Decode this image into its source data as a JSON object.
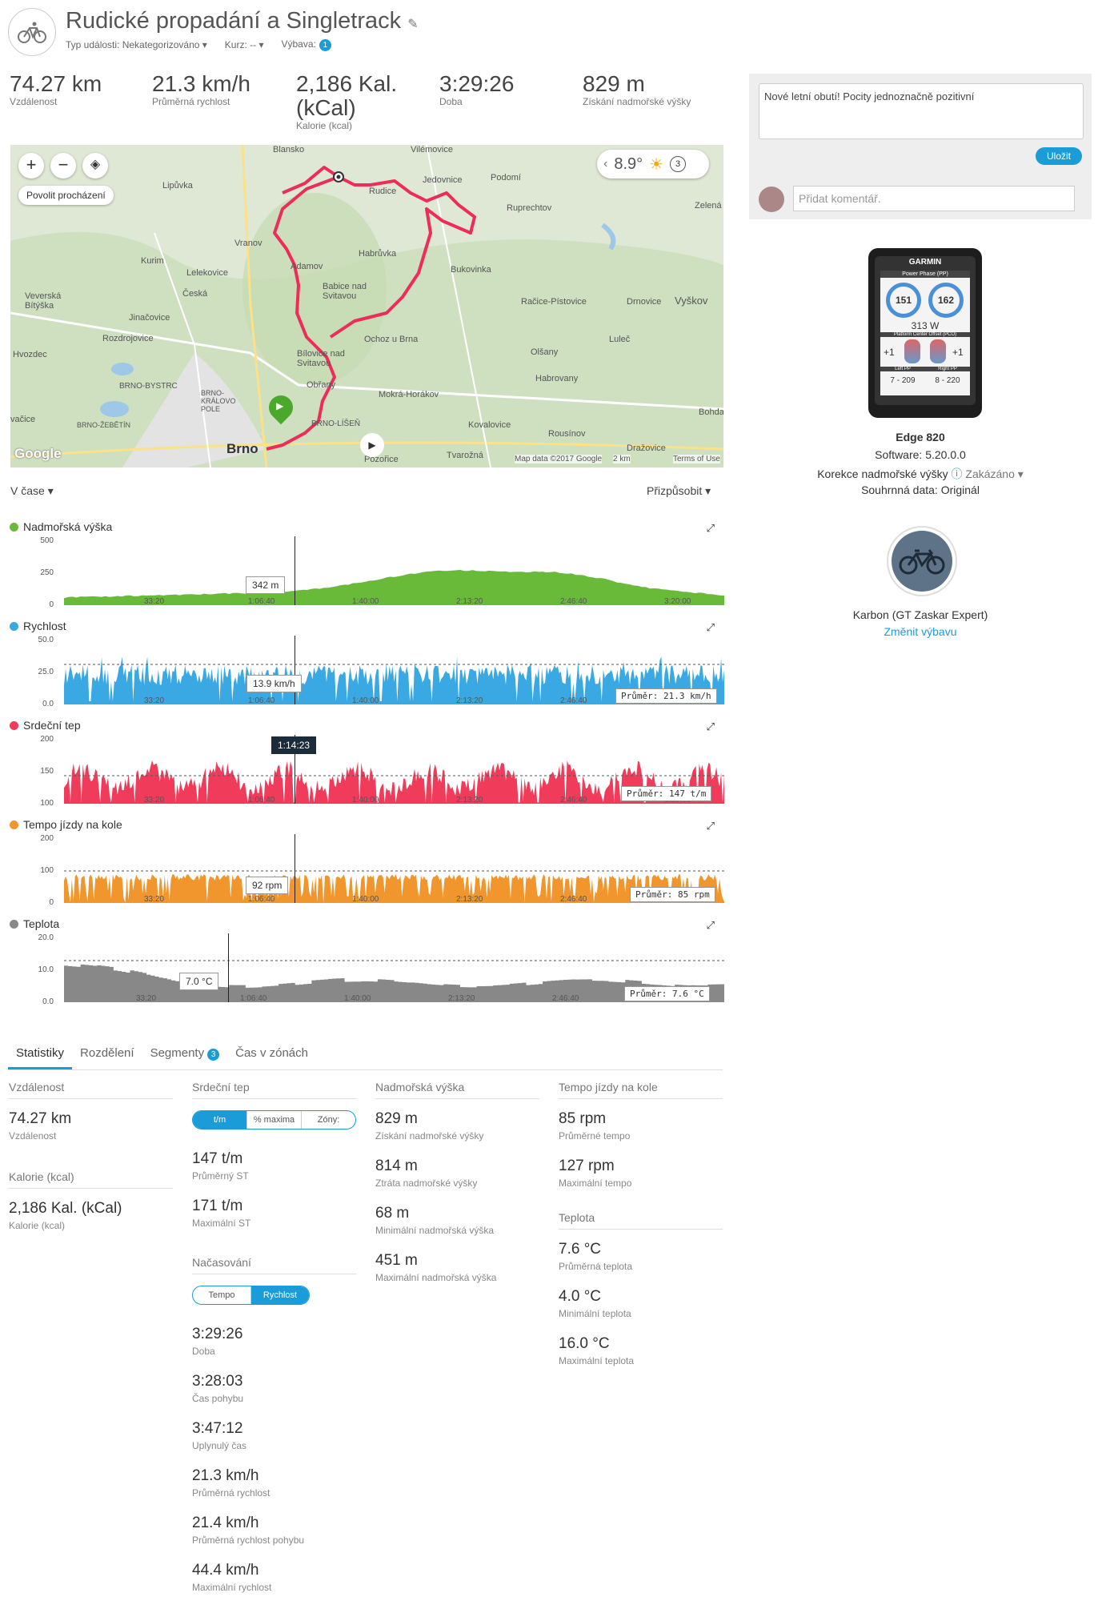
{
  "header": {
    "title": "Rudické propadání a Singletrack",
    "event_type": "Typ události: Nekategorizováno",
    "course": "Kurz: --",
    "gear_label": "Výbava:",
    "gear_count": "1"
  },
  "summary": [
    {
      "value": "74.27 km",
      "label": "Vzdálenost"
    },
    {
      "value": "21.3 km/h",
      "label": "Průměrná rychlost"
    },
    {
      "value": "2,186 Kal. (kCal)",
      "label": "Kalorie (kcal)"
    },
    {
      "value": "3:29:26",
      "label": "Doba"
    },
    {
      "value": "829 m",
      "label": "Získání nadmořské výšky"
    }
  ],
  "map": {
    "pan_label": "Povolit procházení",
    "temperature": "8.9°",
    "lap_count": "3",
    "credits": "Map data ©2017 Google",
    "scale": "2 km",
    "terms": "Terms of Use",
    "google": "Google",
    "places": [
      "Lipůvka",
      "Kurim",
      "Vranov",
      "Lelekovice",
      "Česká",
      "Veverská Bítýška",
      "Jinačovice",
      "Rozdrojovice",
      "Hvozdec",
      "BRNO-BYSTRC",
      "BRNO-KRÁLOVO POLE",
      "BRNO-ŽEBĚTÍN",
      "Brno",
      "Obřany",
      "Bílovice nad Svitavou",
      "Babice nad Svitavou",
      "Adamov",
      "Habrůvka",
      "Rudice",
      "Jedovnice",
      "Podomí",
      "Ruprechtov",
      "Bukovinka",
      "Račice-Pístovice",
      "Drnovice",
      "Vyškov",
      "Luleč",
      "Olšany",
      "Habrovany",
      "Ochoz u Brna",
      "Mokrá-Horákov",
      "BRNO-LÍŠEŇ",
      "Kovalovice",
      "Rousínov",
      "Tvarožná",
      "Pozořice",
      "Dražovice",
      "Zelená",
      "Vilémovice",
      "Blansko",
      "Bohda",
      "vačice"
    ]
  },
  "charts": {
    "mode": "V čase",
    "fit": "Přizpůsobit",
    "x_ticks": [
      "33:20",
      "1:06:40",
      "1:40:00",
      "2:13:20",
      "2:46:40",
      "3:20:00"
    ],
    "cursor_time": "1:14:23",
    "elevation": {
      "title": "Nadmořská výška",
      "color": "#6aba3a",
      "ticks": [
        "500",
        "250",
        "0"
      ],
      "tip": "342 m"
    },
    "speed": {
      "title": "Rychlost",
      "color": "#3aa9e3",
      "ticks": [
        "50.0",
        "25.0",
        "0.0"
      ],
      "tip": "13.9 km/h",
      "avg": "Průměr: 21.3 km/h"
    },
    "hr": {
      "title": "Srdeční tep",
      "color": "#f03c5a",
      "ticks": [
        "200",
        "150",
        "100"
      ],
      "avg": "Průměr: 147 t/m"
    },
    "cadence": {
      "title": "Tempo jízdy na kole",
      "color": "#f0962d",
      "ticks": [
        "200",
        "100",
        "0"
      ],
      "tip": "92 rpm",
      "avg": "Průměr: 85 rpm"
    },
    "temp": {
      "title": "Teplota",
      "color": "#888888",
      "ticks": [
        "20.0",
        "10.0",
        "0.0"
      ],
      "tip": "7.0 °C",
      "avg": "Průměr: 7.6 °C"
    }
  },
  "tabs": {
    "stats": "Statistiky",
    "splits": "Rozdělení",
    "segments": "Segmenty",
    "segments_count": "3",
    "zones": "Čas v zónách"
  },
  "stats": {
    "distance": {
      "header": "Vzdálenost",
      "value": "74.27 km",
      "label": "Vzdálenost"
    },
    "calories": {
      "header": "Kalorie (kcal)",
      "value": "2,186 Kal. (kCal)",
      "label": "Kalorie (kcal)"
    },
    "hr": {
      "header": "Srdeční tep",
      "seg": [
        "t/m",
        "% maxima",
        "Zóny:"
      ],
      "items": [
        {
          "value": "147 t/m",
          "label": "Průměrný ST"
        },
        {
          "value": "171 t/m",
          "label": "Maximální ST"
        }
      ]
    },
    "timing": {
      "header": "Načasování",
      "seg": [
        "Tempo",
        "Rychlost"
      ],
      "items": [
        {
          "value": "3:29:26",
          "label": "Doba"
        },
        {
          "value": "3:28:03",
          "label": "Čas pohybu"
        },
        {
          "value": "3:47:12",
          "label": "Uplynulý čas"
        },
        {
          "value": "21.3 km/h",
          "label": "Průměrná rychlost"
        },
        {
          "value": "21.4 km/h",
          "label": "Průměrná rychlost pohybu"
        },
        {
          "value": "44.4 km/h",
          "label": "Maximální rychlost"
        }
      ]
    },
    "elevation": {
      "header": "Nadmořská výška",
      "items": [
        {
          "value": "829 m",
          "label": "Získání nadmořské výšky"
        },
        {
          "value": "814 m",
          "label": "Ztráta nadmořské výšky"
        },
        {
          "value": "68 m",
          "label": "Minimální nadmořská výška"
        },
        {
          "value": "451 m",
          "label": "Maximální nadmořská výška"
        }
      ]
    },
    "cadence": {
      "header": "Tempo jízdy na kole",
      "items": [
        {
          "value": "85 rpm",
          "label": "Průměrné tempo"
        },
        {
          "value": "127 rpm",
          "label": "Maximální tempo"
        }
      ]
    },
    "temperature": {
      "header": "Teplota",
      "items": [
        {
          "value": "7.6 °C",
          "label": "Průměrná teplota"
        },
        {
          "value": "4.0 °C",
          "label": "Minimální teplota"
        },
        {
          "value": "16.0 °C",
          "label": "Maximální teplota"
        }
      ]
    }
  },
  "notes": {
    "text": "Nové letní obutí! Pocity jednoznačně pozitivní",
    "save": "Uložit",
    "comment_placeholder": "Přidat komentář."
  },
  "device": {
    "name": "Edge 820",
    "software": "Software: 5.20.0.0",
    "elev_corr_label": "Korekce nadmořské výšky",
    "elev_corr_value": "Zakázáno",
    "source": "Souhrnná data: Originál",
    "screen_brand": "GARMIN",
    "screen_title": "Power Phase (PP)",
    "screen_l": "151",
    "screen_r": "162",
    "screen_power": "313 W",
    "screen_pco": "Platform Center Offset (PCO)",
    "screen_pco_l": "+1",
    "screen_pco_r": "+1",
    "screen_lpp": "Left PP",
    "screen_rpp": "Right PP",
    "screen_lpp_v": "7 - 209",
    "screen_rpp_v": "8 - 220"
  },
  "gear": {
    "name": "Karbon (GT Zaskar Expert)",
    "change": "Změnit výbavu"
  }
}
